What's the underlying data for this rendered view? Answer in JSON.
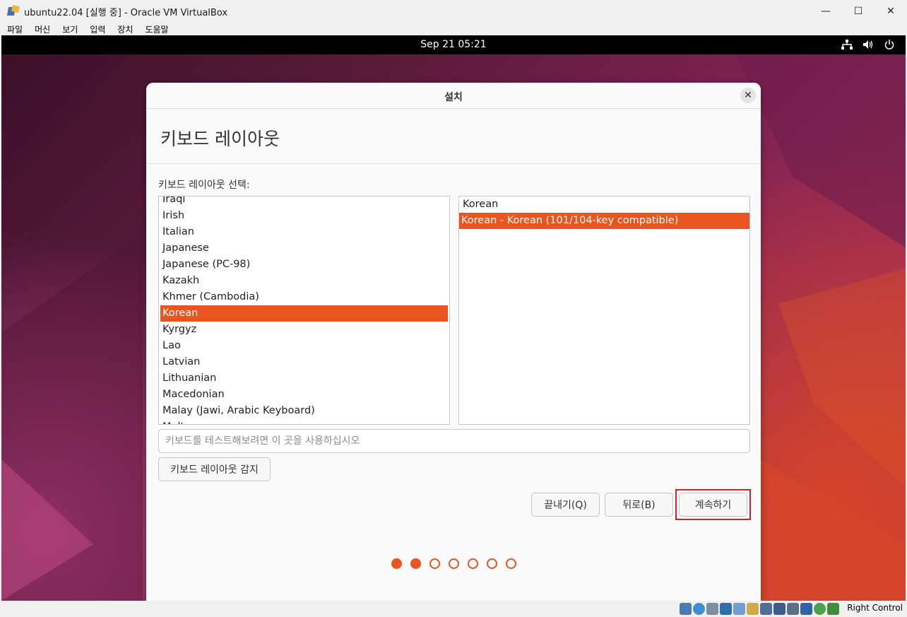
{
  "window": {
    "title": "ubuntu22.04 [실행 중] - Oracle VM VirtualBox",
    "minimize_glyph": "—",
    "maximize_glyph": "☐",
    "close_glyph": "✕"
  },
  "menubar": {
    "items": [
      "파일",
      "머신",
      "보기",
      "입력",
      "장치",
      "도움말"
    ]
  },
  "gnome_topbar": {
    "clock": "Sep 21  05:21",
    "tray_icons": [
      "network-icon",
      "volume-icon",
      "power-icon"
    ]
  },
  "dialog": {
    "title": "설치",
    "close_glyph": "✕",
    "page_title": "키보드 레이아웃",
    "choose_label": "키보드 레이아웃 선택:",
    "layouts": [
      "Iraqi",
      "Irish",
      "Italian",
      "Japanese",
      "Japanese (PC-98)",
      "Kazakh",
      "Khmer (Cambodia)",
      "Korean",
      "Kyrgyz",
      "Lao",
      "Latvian",
      "Lithuanian",
      "Macedonian",
      "Malay (Jawi, Arabic Keyboard)",
      "Maltese"
    ],
    "selected_layout": "Korean",
    "variants": [
      "Korean",
      "Korean - Korean (101/104-key compatible)"
    ],
    "selected_variant": "Korean - Korean (101/104-key compatible)",
    "test_placeholder": "키보드를 테스트해보려면 이 곳을 사용하십시오",
    "test_value": "",
    "detect_button": "키보드 레이아웃 감지",
    "quit_button": "끝내기(Q)",
    "back_button": "뒤로(B)",
    "continue_button": "계속하기",
    "progress": {
      "current_step": 2,
      "total_steps": 7
    }
  },
  "statusbar": {
    "host_key": "Right Control",
    "icons": [
      "hard-disk-icon",
      "optical-drive-icon",
      "audio-icon",
      "network-adapter-icon",
      "usb-icon",
      "shared-folders-icon",
      "display-icon",
      "video-capture-icon",
      "recording-icon",
      "vt-x-icon",
      "mouse-integration-icon",
      "keyboard-capture-icon"
    ],
    "colors": {
      "accent": "#e95420",
      "highlight_frame": "#d81f26"
    }
  }
}
